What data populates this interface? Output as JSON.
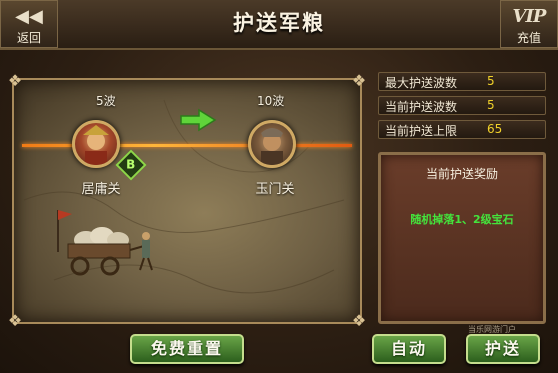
{
  "header": {
    "back_label": "返回",
    "title": "护送军粮",
    "vip_label": "VIP",
    "recharge_label": "充值"
  },
  "route": {
    "start": {
      "name": "居庸关",
      "waves": "5波",
      "badge": "B"
    },
    "end": {
      "name": "玉门关",
      "waves": "10波"
    }
  },
  "stats": [
    {
      "label": "最大护送波数",
      "value": "5"
    },
    {
      "label": "当前护送波数",
      "value": "5"
    },
    {
      "label": "当前护送上限",
      "value": "65"
    }
  ],
  "reward": {
    "title": "当前护送奖励",
    "text": "随机掉落1、2级宝石"
  },
  "buttons": {
    "reset": "免费重置",
    "auto": "自动",
    "escort": "护送"
  },
  "watermark": "当乐网游门户",
  "colors": {
    "accent_yellow": "#f0d12a",
    "reward_green": "#44e33c",
    "button_green": "#4d8a33"
  }
}
